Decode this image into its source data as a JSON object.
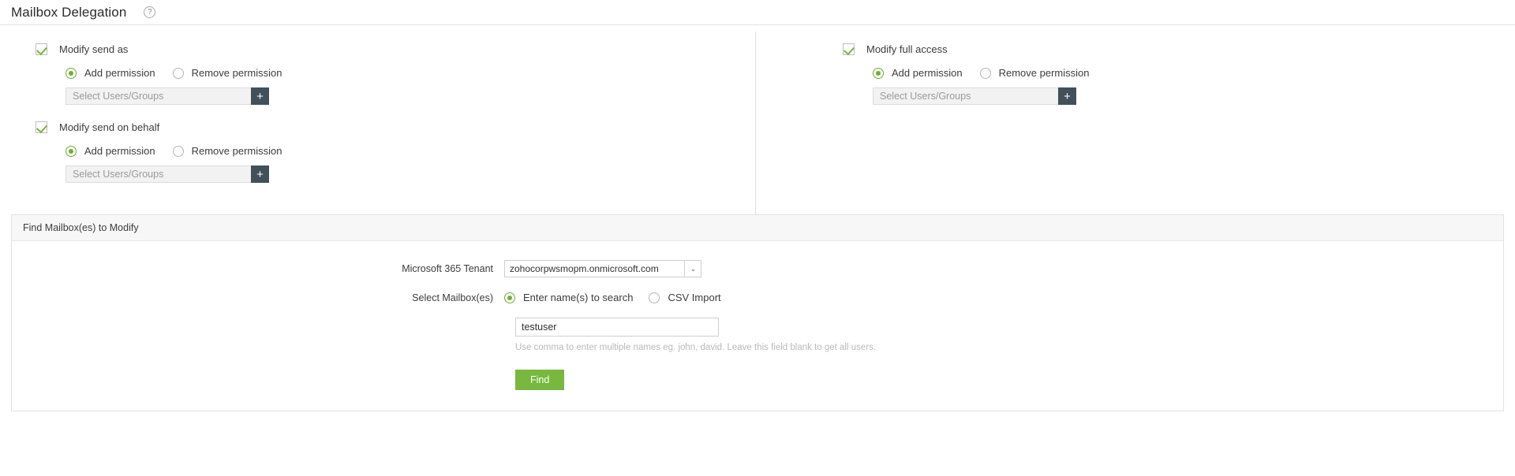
{
  "header": {
    "title": "Mailbox Delegation",
    "help_icon": "help-circle-icon",
    "help_glyph": "?"
  },
  "delegation": {
    "left_column": [
      {
        "checkbox_label": "Modify send as",
        "checked": true,
        "radios": [
          {
            "label": "Add permission",
            "selected": true
          },
          {
            "label": "Remove permission",
            "selected": false
          }
        ],
        "users_placeholder": "Select Users/Groups",
        "users_value": "",
        "add_glyph": "+"
      },
      {
        "checkbox_label": "Modify send on behalf",
        "checked": true,
        "radios": [
          {
            "label": "Add permission",
            "selected": true
          },
          {
            "label": "Remove permission",
            "selected": false
          }
        ],
        "users_placeholder": "Select Users/Groups",
        "users_value": "",
        "add_glyph": "+"
      }
    ],
    "right_column": [
      {
        "checkbox_label": "Modify full access",
        "checked": true,
        "radios": [
          {
            "label": "Add permission",
            "selected": true
          },
          {
            "label": "Remove permission",
            "selected": false
          }
        ],
        "users_placeholder": "Select Users/Groups",
        "users_value": "",
        "add_glyph": "+"
      }
    ]
  },
  "find_panel": {
    "title": "Find Mailbox(es) to Modify",
    "tenant_label": "Microsoft 365 Tenant",
    "tenant_value": "zohocorpwsmopm.onmicrosoft.com",
    "tenant_options": [
      "zohocorpwsmopm.onmicrosoft.com"
    ],
    "caret_glyph": "⌄",
    "mailbox_label": "Select Mailbox(es)",
    "mailbox_radios": [
      {
        "label": "Enter name(s) to search",
        "selected": true
      },
      {
        "label": "CSV Import",
        "selected": false
      }
    ],
    "name_value": "testuser",
    "name_placeholder": "",
    "hint": "Use comma to enter multiple names eg. john, david. Leave this field blank to get all users.",
    "find_label": "Find"
  },
  "colors": {
    "accent_green": "#78b83e",
    "check_green": "#7cb342",
    "radio_green": "#6fae35",
    "add_button": "#42505a",
    "panel_header_bg": "#f7f7f7"
  }
}
